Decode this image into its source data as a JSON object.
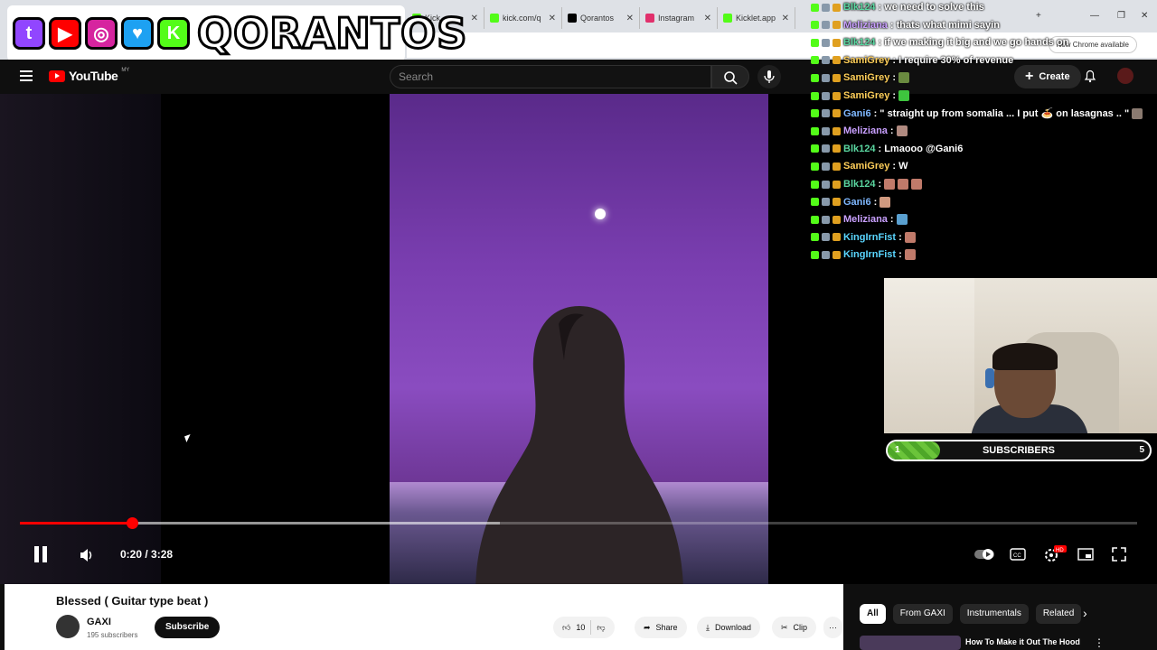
{
  "browser": {
    "tabs": [
      {
        "label": "Kick",
        "color": "#53fc18"
      },
      {
        "label": "kick.com/q",
        "color": "#53fc18"
      },
      {
        "label": "Qorantos",
        "color": "#000000"
      },
      {
        "label": "Instagram",
        "color": "#e1306c"
      },
      {
        "label": "Kicklet.app",
        "color": "#53fc18"
      }
    ],
    "new_chrome_label": "New Chrome available"
  },
  "overlay": {
    "brand_name": "QORANTOS",
    "socials": [
      {
        "icon": "twitch-icon",
        "color": "#9146ff",
        "glyph": "t"
      },
      {
        "icon": "youtube-icon",
        "color": "#ff0000",
        "glyph": "▶"
      },
      {
        "icon": "instagram-icon",
        "color": "#d6249f",
        "glyph": "◎"
      },
      {
        "icon": "twitter-icon",
        "color": "#1da1f2",
        "glyph": "♥"
      },
      {
        "icon": "kick-icon",
        "color": "#53fc18",
        "glyph": "K"
      }
    ]
  },
  "youtube": {
    "logo_text": "YouTube",
    "region": "MY",
    "search_placeholder": "Search",
    "create_label": "Create"
  },
  "player": {
    "time": "0:20 / 3:28",
    "progress_fraction": 0.1,
    "buffered_fraction": 0.43
  },
  "chat": [
    {
      "user": "Blk124",
      "color": "#5ad6a0",
      "msg": ": we need to solve this",
      "emotes": []
    },
    {
      "user": "Meliziana",
      "color": "#c9a0ff",
      "msg": ": thats what mimi sayin",
      "emotes": []
    },
    {
      "user": "Blk124",
      "color": "#5ad6a0",
      "msg": ": if we making it big and we go hands on",
      "emotes": []
    },
    {
      "user": "SamiGrey",
      "color": "#ffcf5a",
      "msg": ": I require 30% of revenue",
      "emotes": []
    },
    {
      "user": "SamiGrey",
      "color": "#ffcf5a",
      "msg": ":",
      "emotes": [
        "#6a8a40"
      ]
    },
    {
      "user": "SamiGrey",
      "color": "#ffcf5a",
      "msg": ":",
      "emotes": [
        "#3ec43e"
      ]
    },
    {
      "user": "Gani6",
      "color": "#7fb8ff",
      "msg": ": \" straight up from somalia ... I put 🍝 on lasagnas .. \"",
      "emotes": [
        "#8a7a70"
      ]
    },
    {
      "user": "Meliziana",
      "color": "#c9a0ff",
      "msg": ":",
      "emotes": [
        "#b08a80"
      ]
    },
    {
      "user": "Blk124",
      "color": "#5ad6a0",
      "msg": ": Lmaooo @Gani6",
      "emotes": []
    },
    {
      "user": "SamiGrey",
      "color": "#ffcf5a",
      "msg": ": W",
      "emotes": []
    },
    {
      "user": "Blk124",
      "color": "#5ad6a0",
      "msg": ":",
      "emotes": [
        "#c07a6a",
        "#c07a6a",
        "#c07a6a"
      ]
    },
    {
      "user": "Gani6",
      "color": "#7fb8ff",
      "msg": ":",
      "emotes": [
        "#d09a80"
      ]
    },
    {
      "user": "Meliziana",
      "color": "#c9a0ff",
      "msg": ":",
      "emotes": [
        "#5aa0d0"
      ]
    },
    {
      "user": "KingIrnFist",
      "color": "#5ad6ff",
      "msg": ":",
      "emotes": [
        "#c07a6a"
      ]
    },
    {
      "user": "KingIrnFist",
      "color": "#5ad6ff",
      "msg": ":",
      "emotes": [
        "#c07a6a"
      ]
    }
  ],
  "subgoal": {
    "current": "1",
    "label": "SUBSCRIBERS",
    "target": "5",
    "fill_fraction": 0.2
  },
  "video": {
    "title": "Blessed ( Guitar type beat )",
    "channel": "GAXI",
    "subscribers": "195 subscribers",
    "subscribe_label": "Subscribe",
    "likes": "10",
    "share_label": "Share",
    "download_label": "Download",
    "clip_label": "Clip"
  },
  "sidebar": {
    "chips": [
      "All",
      "From GAXI",
      "Instrumentals",
      "Related"
    ],
    "rec_title": "How To Make it Out The Hood"
  }
}
